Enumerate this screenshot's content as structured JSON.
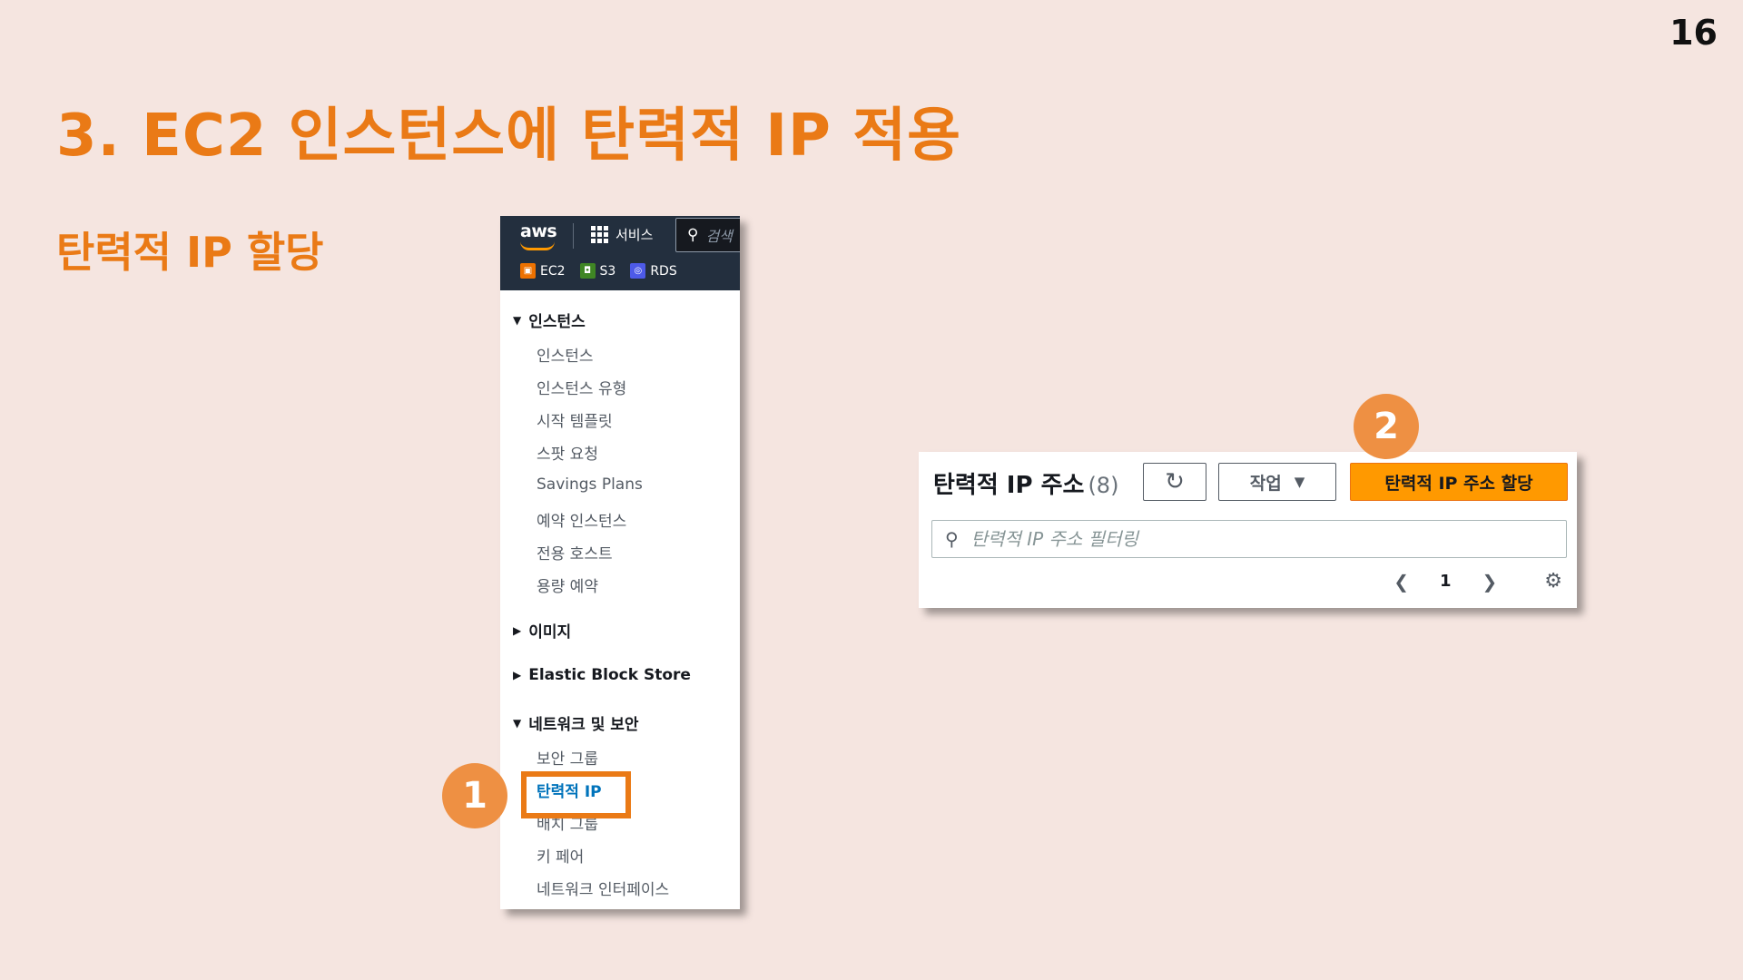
{
  "slide": {
    "page_number": "16",
    "title": "3. EC2 인스턴스에 탄력적 IP 적용",
    "section": "탄력적 IP 할당"
  },
  "aws_console": {
    "logo": "aws",
    "services_label": "서비스",
    "search_placeholder": "검색",
    "favorites": [
      {
        "label": "EC2",
        "icon": "ec2-icon"
      },
      {
        "label": "S3",
        "icon": "s3-icon"
      },
      {
        "label": "RDS",
        "icon": "rds-icon"
      }
    ],
    "nav": {
      "instances_group": "인스턴스",
      "instances_items": [
        "인스턴스",
        "인스턴스 유형",
        "시작 템플릿",
        "스팟 요청",
        "Savings Plans",
        "예약 인스턴스",
        "전용 호스트",
        "용량 예약"
      ],
      "images_group": "이미지",
      "ebs_group": "Elastic Block Store",
      "network_group": "네트워크 및 보안",
      "network_items": [
        "보안 그룹",
        "탄력적 IP",
        "배치 그룹",
        "키 페어",
        "네트워크 인터페이스"
      ]
    }
  },
  "steps": {
    "one": "1",
    "two": "2"
  },
  "elastic_ip_panel": {
    "title": "탄력적 IP 주소",
    "count": "(8)",
    "actions_label": "작업",
    "allocate_label": "탄력적 IP 주소 할당",
    "filter_placeholder": "탄력적 IP 주소 필터링",
    "current_page": "1"
  },
  "colors": {
    "accent": "#ea7a16",
    "background": "#f5e5e0",
    "aws_nav": "#232f3e",
    "primary_button": "#ff9900",
    "active_link": "#0073bb"
  }
}
